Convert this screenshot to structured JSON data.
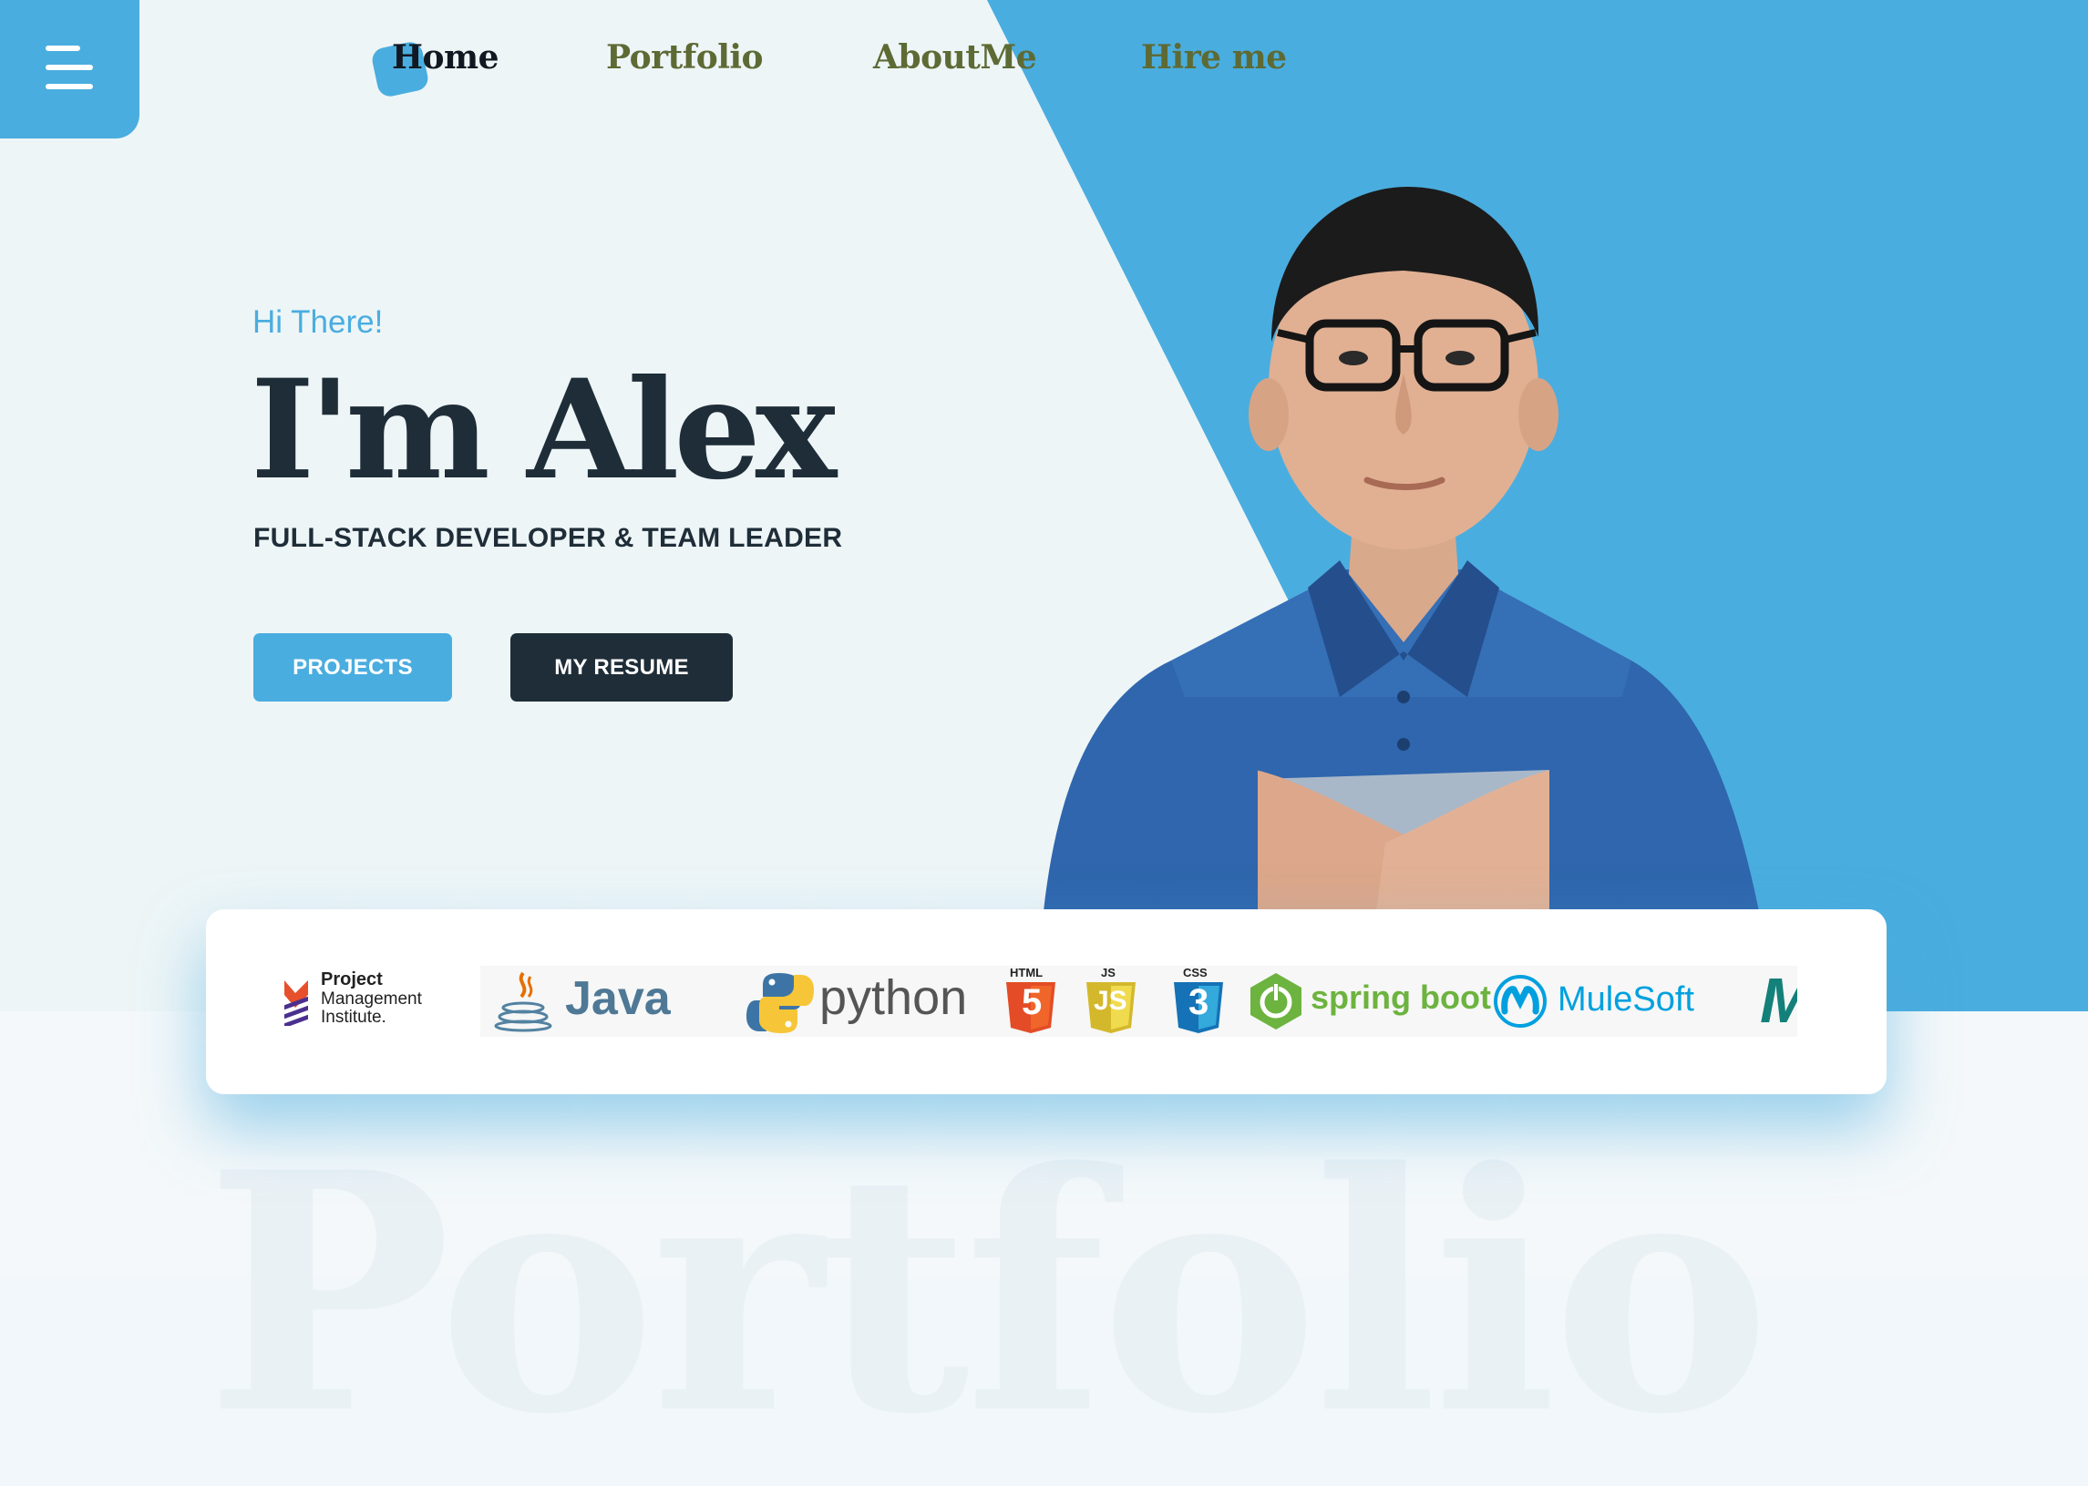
{
  "nav": {
    "menu_icon": "hamburger-menu-icon",
    "items": [
      {
        "label": "Home",
        "active": true
      },
      {
        "label": "Portfolio",
        "active": false
      },
      {
        "label": "AboutMe",
        "active": false
      },
      {
        "label": "Hire me",
        "active": false
      }
    ]
  },
  "hero": {
    "greeting": "Hi There!",
    "headline": "I'm Alex",
    "subtitle": "FULL-STACK DEVELOPER & TEAM LEADER",
    "projects_label": "PROJECTS",
    "resume_label": "MY RESUME"
  },
  "skills": {
    "pmi": [
      "Project",
      "Management",
      "Institute."
    ],
    "java": "Java",
    "python": "python",
    "html": "HTML",
    "html_num": "5",
    "js": "JS",
    "js_mark": "JS",
    "css": "CSS",
    "css_num": "3",
    "spring": "spring boot",
    "mulesoft": "MuleSoft",
    "partial": "M"
  },
  "background_text": "Portfolio",
  "colors": {
    "accent": "#4aaddf",
    "dark": "#1f2d38",
    "nav_inactive": "#5e6a34",
    "hero_bg": "#edf5f7"
  }
}
